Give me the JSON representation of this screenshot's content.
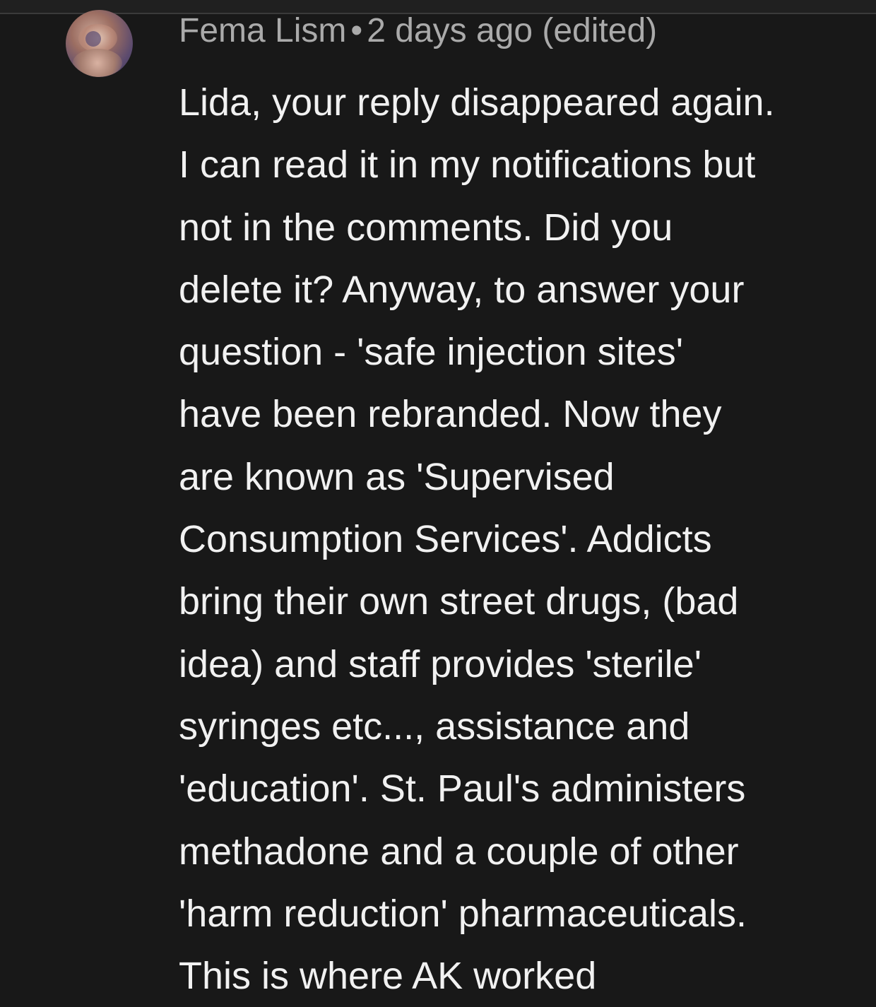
{
  "comment": {
    "avatar_icon": "user-avatar-icon",
    "author": "Fema Lism",
    "separator": "•",
    "timestamp": "2 days ago (edited)",
    "text": "Lida, your reply disappeared again.\nI can read it in my notifications but\nnot in the comments.  Did you\ndelete it?  Anyway, to answer your\nquestion - 'safe injection sites'\nhave been rebranded.  Now they\nare known as 'Supervised\nConsumption Services'.  Addicts\nbring their own street drugs, (bad\nidea) and staff provides 'sterile'\nsyringes etc..., assistance and\n'education'.  St. Paul's administers\nmethadone and a couple of other\n'harm reduction' pharmaceuticals.\nThis is where AK worked"
  },
  "colors": {
    "background": "#181818",
    "meta_text": "#aaaaaa",
    "body_text": "#f1f1f1"
  }
}
